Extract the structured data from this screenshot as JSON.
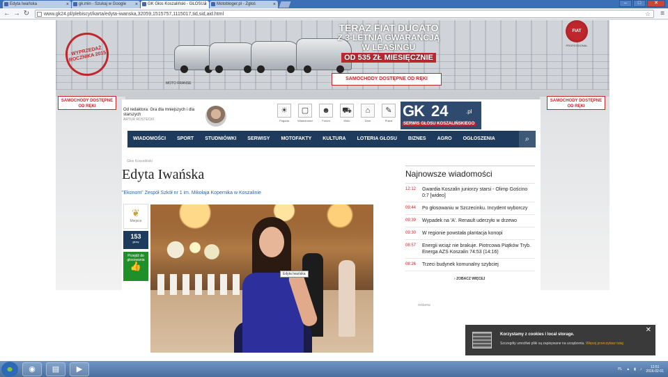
{
  "browser": {
    "tabs": [
      {
        "label": "Edyta Iwańska",
        "active": false
      },
      {
        "label": "gk.min - Szukaj w Google",
        "active": false
      },
      {
        "label": "GK Głos Koszaliński - GŁOSUJ",
        "active": true
      },
      {
        "label": "Motobloger.pl - Zgłoś",
        "active": false
      }
    ],
    "url": "www.gk24.pl/plebiscyt/karta/edyta-iwanska,32059,1515757,1115017,tid,sid,aid.html"
  },
  "ad": {
    "stamp": "WYPRZEDAŻ ROCZNIKA 2015",
    "headline1": "TERAZ FIAT DUCATO",
    "headline2": "Z 3-LETNIĄ GWARANCJĄ",
    "headline3": "W LEASINGU",
    "price": "OD 535 ZŁ MIESIĘCZNIE",
    "button": "SAMOCHODY DOSTĘPNE OD RĘKI",
    "brand": "FIAT",
    "brand_sub": "PROFESSIONAL",
    "caption": "MOTO FRANSE",
    "side_left": "SAMOCHODY DOSTĘPNE OD RĘKI",
    "side_right": "SAMOCHODY DOSTĘPNE OD RĘKI"
  },
  "header": {
    "promo_text": "Od redaktora: Gra dla mniejszych i dla starszych",
    "promo_author": "ARTUR ROSTECKI",
    "icons": [
      {
        "name": "pogoda-icon",
        "glyph": "☀",
        "label": "Pogoda"
      },
      {
        "name": "wiadomosci-icon",
        "glyph": "▢",
        "label": "Wiadomości"
      },
      {
        "name": "forum-icon",
        "glyph": "☻",
        "label": "Forum"
      },
      {
        "name": "moto-icon",
        "glyph": "⛟",
        "label": "Moto"
      },
      {
        "name": "dom-icon",
        "glyph": "⌂",
        "label": "Dom"
      },
      {
        "name": "praca-icon",
        "glyph": "✎",
        "label": "Praca"
      }
    ],
    "logo_gk": "GK",
    "logo_num": "24",
    "logo_pl": ".pl",
    "logo_sub": "SERWIS GŁOSU KOSZALIŃSKIEGO"
  },
  "menu": [
    "WIADOMOŚCI",
    "SPORT",
    "STUDNIÓWKI",
    "SERWISY",
    "MOTOFAKTY",
    "KULTURA",
    "LOTERIA GŁOSU",
    "BIZNES",
    "AGRO",
    "OGŁOSZENIA"
  ],
  "article": {
    "breadcrumb": "Głos Koszaliński",
    "title": "Edyta Iwańska",
    "school": "\"Ekonom\" Zespół Szkół nr 1 im. Mikołaja Kopernika w Koszalinie",
    "place_label": "Miejsce",
    "votes": "153",
    "votes_label": "głosy",
    "vote_button": "Przejdź do głosowania",
    "photo_tag": "Edyta Iwańska"
  },
  "sidebar": {
    "title": "Najnowsze wiadomości",
    "news": [
      {
        "time": "12:12",
        "text": "Gwardia Koszalin juniorzy starsi - Olimp Gościno 0:7 [wideo]"
      },
      {
        "time": "09:44",
        "text": "Po głosowaniu w Szczecinku. Incydent wyborczy"
      },
      {
        "time": "09:39",
        "text": "Wypadek na 'A'. Renault uderzyło w drzewo"
      },
      {
        "time": "09:30",
        "text": "W regionie powstała plantacja konopi"
      },
      {
        "time": "08:57",
        "text": "Energii wciąż nie brakuje. Piotrcowa Piątków Tryb. Energa AZS Koszalin 74:53 (14:16)"
      },
      {
        "time": "08:26",
        "text": "Trzeci budynek komunalny szybciej"
      }
    ],
    "more": "ZOBACZ WIĘCEJ",
    "reklama": "reklama"
  },
  "cookie": {
    "title": "Korzystamy z cookies i local storage.",
    "desc": "Szczegóły umożliwi pliki są zapisywane na urządzeniu.",
    "link": "Więcej przeczytasz tutaj"
  },
  "taskbar": {
    "lang": "PL",
    "time": "12:51",
    "date": "2016-02-01"
  }
}
